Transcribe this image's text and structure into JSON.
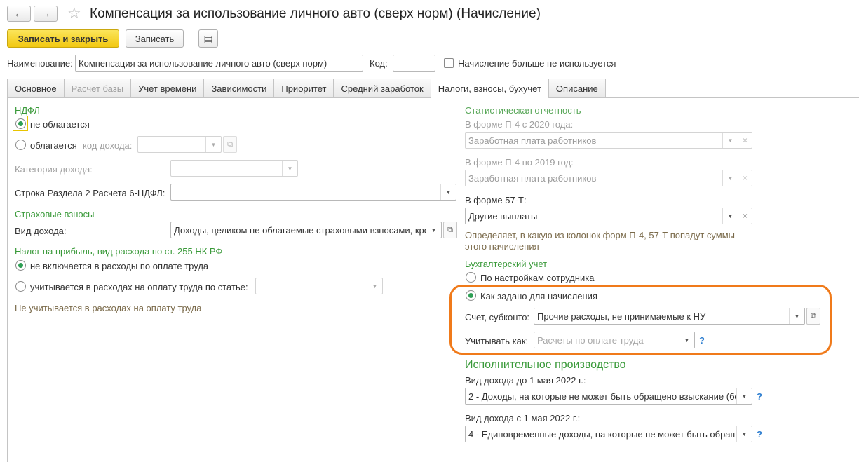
{
  "window": {
    "title": "Компенсация за использование личного авто (сверх норм) (Начисление)",
    "back_icon": "←",
    "forward_icon": "→",
    "star_icon": "☆"
  },
  "toolbar": {
    "save_close_label": "Записать и закрыть",
    "save_label": "Записать",
    "more_icon": "▤"
  },
  "header": {
    "name_label": "Наименование:",
    "name_value": "Компенсация за использование личного авто (сверх норм)",
    "code_label": "Код:",
    "code_value": "",
    "unused_label": "Начисление больше не используется"
  },
  "tabs": [
    {
      "label": "Основное"
    },
    {
      "label": "Расчет базы"
    },
    {
      "label": "Учет времени"
    },
    {
      "label": "Зависимости"
    },
    {
      "label": "Приоритет"
    },
    {
      "label": "Средний заработок"
    },
    {
      "label": "Налоги, взносы, бухучет"
    },
    {
      "label": "Описание"
    }
  ],
  "left": {
    "ndfl_header": "НДФЛ",
    "not_taxed_label": "не облагается",
    "taxed_label": "облагается",
    "income_code_label": "код дохода:",
    "income_category_label": "Категория дохода:",
    "row_6ndfl_label": "Строка Раздела 2 Расчета 6-НДФЛ:",
    "insurance_header": "Страховые взносы",
    "income_type_label": "Вид дохода:",
    "income_type_value": "Доходы, целиком не облагаемые страховыми взносами, кро",
    "profit_tax_header": "Налог на прибыль, вид расхода по ст. 255 НК РФ",
    "not_included_label": "не включается в расходы по оплате труда",
    "included_label": "учитывается в расходах на оплату труда по статье:",
    "note": "Не учитывается в расходах на оплату труда"
  },
  "right": {
    "stat_header": "Статистическая отчетность",
    "p4_2020_label": "В форме П-4 с 2020 года:",
    "p4_2020_value": "Заработная плата работников",
    "p4_2019_label": "В форме П-4 по 2019 год:",
    "p4_2019_value": "Заработная плата работников",
    "f57t_label": "В форме 57-Т:",
    "f57t_value": "Другие выплаты",
    "stat_note_line1": "Определяет, в какую из колонок форм П-4, 57-Т попадут суммы",
    "stat_note_line2": "этого начисления",
    "accounting_header": "Бухгалтерский учет",
    "by_employee_label": "По настройкам сотрудника",
    "as_set_label": "Как задано для начисления",
    "account_label": "Счет, субконто:",
    "account_value": "Прочие расходы, не принимаемые к НУ",
    "account_as_label": "Учитывать как:",
    "account_as_placeholder": "Расчеты по оплате труда",
    "enforcement_header": "Исполнительное производство",
    "before_label": "Вид дохода до 1 мая 2022 г.:",
    "before_value": "2 - Доходы, на которые не может быть обращено взыскание (бе",
    "after_label": "Вид дохода с 1 мая 2022 г.:",
    "after_value": "4 - Единовременные доходы, на которые не может быть обращ",
    "help_mark": "?"
  },
  "colors": {
    "accent_yellow": "#f2c811",
    "section_green": "#3a9a3a",
    "highlight_orange": "#f07a1a",
    "help_blue": "#2f7fd0"
  }
}
